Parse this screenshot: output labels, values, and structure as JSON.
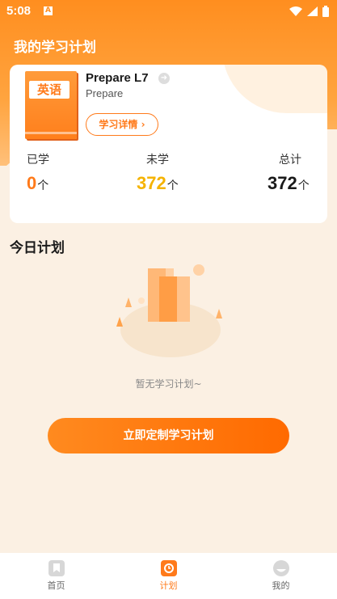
{
  "status": {
    "time": "5:08",
    "a_badge": "A"
  },
  "header": {
    "title": "我的学习计划"
  },
  "plan_card": {
    "book_cover_label": "英语",
    "book_title": "Prepare L7",
    "book_subtitle": "Prepare",
    "detail_button": "学习详情",
    "stats": [
      {
        "label": "已学",
        "value": "0",
        "unit": "个",
        "color": "#FF7A1A"
      },
      {
        "label": "未学",
        "value": "372",
        "unit": "个",
        "color": "#F5B300"
      },
      {
        "label": "总计",
        "value": "372",
        "unit": "个",
        "color": "#1a1a1a"
      }
    ]
  },
  "today": {
    "title": "今日计划",
    "empty_text": "暂无学习计划~",
    "cta_label": "立即定制学习计划"
  },
  "tabs": [
    {
      "label": "首页",
      "icon": "bookmark-icon",
      "active": false
    },
    {
      "label": "计划",
      "icon": "clock-icon",
      "active": true
    },
    {
      "label": "我的",
      "icon": "profile-icon",
      "active": false
    }
  ],
  "colors": {
    "accent": "#FF7A1A",
    "bg": "#FBF0E3"
  }
}
